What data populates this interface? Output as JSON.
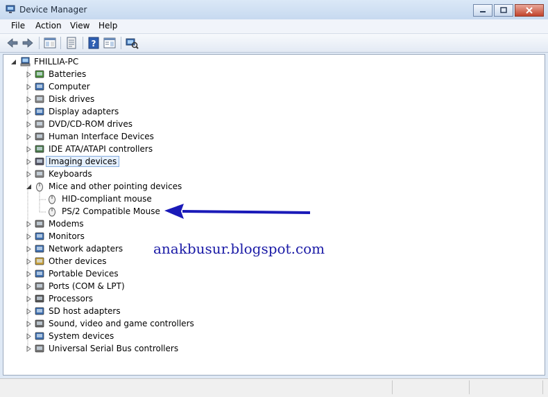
{
  "window": {
    "title": "Device Manager",
    "controls": [
      "minimize",
      "maximize",
      "close"
    ]
  },
  "menu": [
    {
      "label": "File"
    },
    {
      "label": "Action"
    },
    {
      "label": "View"
    },
    {
      "label": "Help"
    }
  ],
  "toolbar": [
    {
      "icon": "back-arrow-icon"
    },
    {
      "icon": "forward-arrow-icon"
    },
    {
      "icon": "console-tree-icon"
    },
    {
      "icon": "properties-icon"
    },
    {
      "icon": "help-icon"
    },
    {
      "icon": "action-pane-icon"
    },
    {
      "icon": "scan-hardware-icon"
    }
  ],
  "tree": {
    "root": "FHILLIA-PC",
    "categories": [
      {
        "label": "Batteries",
        "icon": "battery-icon"
      },
      {
        "label": "Computer",
        "icon": "computer-icon"
      },
      {
        "label": "Disk drives",
        "icon": "disk-drive-icon"
      },
      {
        "label": "Display adapters",
        "icon": "display-adapter-icon"
      },
      {
        "label": "DVD/CD-ROM drives",
        "icon": "dvd-drive-icon"
      },
      {
        "label": "Human Interface Devices",
        "icon": "hid-icon"
      },
      {
        "label": "IDE ATA/ATAPI controllers",
        "icon": "ide-controller-icon"
      },
      {
        "label": "Imaging devices",
        "icon": "camera-icon",
        "selected": true
      },
      {
        "label": "Keyboards",
        "icon": "keyboard-icon"
      },
      {
        "label": "Mice and other pointing devices",
        "icon": "mouse-icon",
        "expanded": true,
        "children": [
          "HID-compliant mouse",
          "PS/2 Compatible Mouse"
        ]
      },
      {
        "label": "Modems",
        "icon": "modem-icon"
      },
      {
        "label": "Monitors",
        "icon": "monitor-icon"
      },
      {
        "label": "Network adapters",
        "icon": "network-adapter-icon"
      },
      {
        "label": "Other devices",
        "icon": "unknown-device-icon"
      },
      {
        "label": "Portable Devices",
        "icon": "portable-device-icon"
      },
      {
        "label": "Ports (COM & LPT)",
        "icon": "port-icon"
      },
      {
        "label": "Processors",
        "icon": "processor-icon"
      },
      {
        "label": "SD host adapters",
        "icon": "sd-card-icon"
      },
      {
        "label": "Sound, video and game controllers",
        "icon": "sound-icon"
      },
      {
        "label": "System devices",
        "icon": "system-device-icon"
      },
      {
        "label": "Universal Serial Bus controllers",
        "icon": "usb-icon"
      }
    ]
  },
  "annotation": {
    "text": "anakbusur.blogspot.com",
    "arrow_color": "#1a1ab8"
  },
  "colors": {
    "selection_border": "#84acdd",
    "selection_fill": "#e5f0fd",
    "annotation_text": "#1a1aa6"
  }
}
